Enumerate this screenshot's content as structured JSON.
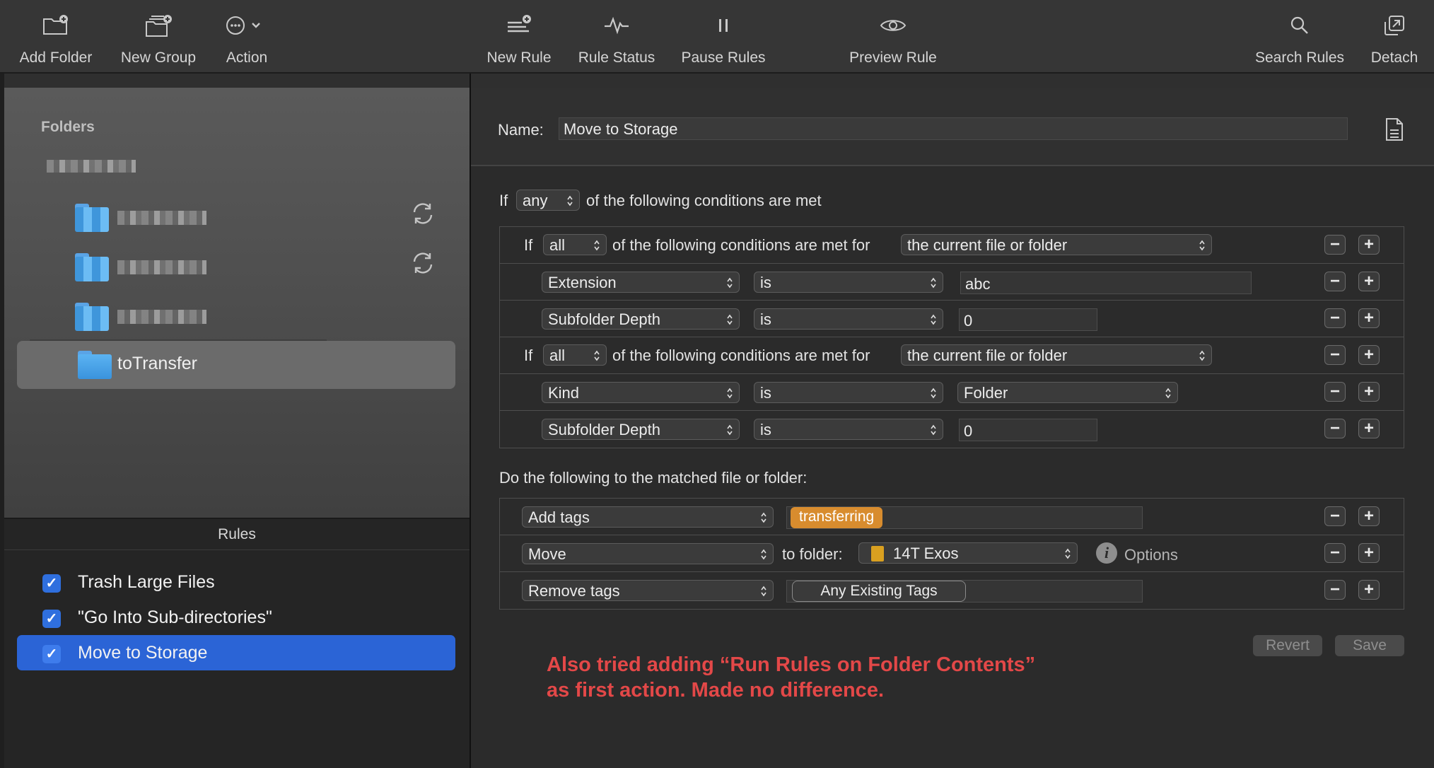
{
  "toolbar": {
    "add_folder": "Add Folder",
    "new_group": "New Group",
    "action": "Action",
    "new_rule": "New Rule",
    "rule_status": "Rule Status",
    "pause_rules": "Pause Rules",
    "preview_rule": "Preview Rule",
    "search_rules": "Search Rules",
    "detach": "Detach"
  },
  "folders": {
    "header": "Folders",
    "selected_folder": "toTransfer"
  },
  "rules": {
    "header": "Rules",
    "items": [
      {
        "label": "Trash Large Files",
        "checked": true
      },
      {
        "label": "\"Go Into Sub-directories\"",
        "checked": true
      },
      {
        "label": "Move to Storage",
        "checked": true
      }
    ]
  },
  "editor": {
    "name_label": "Name:",
    "name_value": "Move to Storage",
    "top_if": "If",
    "top_quantifier": "any",
    "top_suffix": "of the following conditions are met",
    "groups": [
      {
        "if": "If",
        "quantifier": "all",
        "middle": "of the following conditions are met for",
        "target": "the current file or folder",
        "conditions": [
          {
            "attribute": "Extension",
            "operator": "is",
            "value": "abc"
          },
          {
            "attribute": "Subfolder Depth",
            "operator": "is",
            "value": "0"
          }
        ]
      },
      {
        "if": "If",
        "quantifier": "all",
        "middle": "of the following conditions are met for",
        "target": "the current file or folder",
        "conditions": [
          {
            "attribute": "Kind",
            "operator": "is",
            "value": "Folder"
          },
          {
            "attribute": "Subfolder Depth",
            "operator": "is",
            "value": "0"
          }
        ]
      }
    ],
    "actions_heading": "Do the following to the matched file or folder:",
    "actions": [
      {
        "action": "Add tags",
        "tag": "transferring"
      },
      {
        "action": "Move",
        "to_folder_label": "to folder:",
        "folder": "14T Exos",
        "options": "Options"
      },
      {
        "action": "Remove tags",
        "tag_button": "Any Existing Tags"
      }
    ],
    "revert": "Revert",
    "save": "Save",
    "note_line1": "Also tried adding “Run Rules on Folder Contents”",
    "note_line2": "as first action. Made no difference."
  },
  "colors": {
    "accent": "#2b64d6",
    "tag": "#d88c2e",
    "note": "#e34848"
  }
}
